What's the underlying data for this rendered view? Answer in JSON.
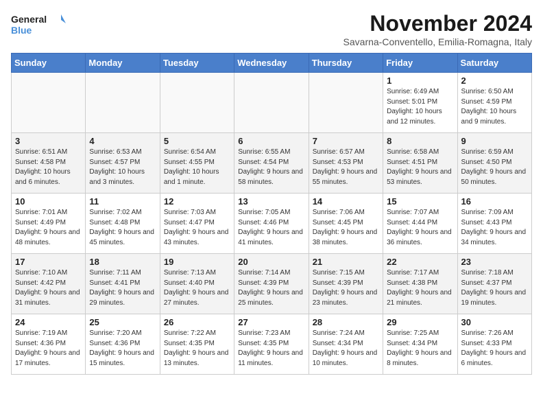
{
  "header": {
    "logo_line1": "General",
    "logo_line2": "Blue",
    "month": "November 2024",
    "location": "Savarna-Conventello, Emilia-Romagna, Italy"
  },
  "columns": [
    "Sunday",
    "Monday",
    "Tuesday",
    "Wednesday",
    "Thursday",
    "Friday",
    "Saturday"
  ],
  "weeks": [
    [
      {
        "day": "",
        "info": ""
      },
      {
        "day": "",
        "info": ""
      },
      {
        "day": "",
        "info": ""
      },
      {
        "day": "",
        "info": ""
      },
      {
        "day": "",
        "info": ""
      },
      {
        "day": "1",
        "info": "Sunrise: 6:49 AM\nSunset: 5:01 PM\nDaylight: 10 hours and 12 minutes."
      },
      {
        "day": "2",
        "info": "Sunrise: 6:50 AM\nSunset: 4:59 PM\nDaylight: 10 hours and 9 minutes."
      }
    ],
    [
      {
        "day": "3",
        "info": "Sunrise: 6:51 AM\nSunset: 4:58 PM\nDaylight: 10 hours and 6 minutes."
      },
      {
        "day": "4",
        "info": "Sunrise: 6:53 AM\nSunset: 4:57 PM\nDaylight: 10 hours and 3 minutes."
      },
      {
        "day": "5",
        "info": "Sunrise: 6:54 AM\nSunset: 4:55 PM\nDaylight: 10 hours and 1 minute."
      },
      {
        "day": "6",
        "info": "Sunrise: 6:55 AM\nSunset: 4:54 PM\nDaylight: 9 hours and 58 minutes."
      },
      {
        "day": "7",
        "info": "Sunrise: 6:57 AM\nSunset: 4:53 PM\nDaylight: 9 hours and 55 minutes."
      },
      {
        "day": "8",
        "info": "Sunrise: 6:58 AM\nSunset: 4:51 PM\nDaylight: 9 hours and 53 minutes."
      },
      {
        "day": "9",
        "info": "Sunrise: 6:59 AM\nSunset: 4:50 PM\nDaylight: 9 hours and 50 minutes."
      }
    ],
    [
      {
        "day": "10",
        "info": "Sunrise: 7:01 AM\nSunset: 4:49 PM\nDaylight: 9 hours and 48 minutes."
      },
      {
        "day": "11",
        "info": "Sunrise: 7:02 AM\nSunset: 4:48 PM\nDaylight: 9 hours and 45 minutes."
      },
      {
        "day": "12",
        "info": "Sunrise: 7:03 AM\nSunset: 4:47 PM\nDaylight: 9 hours and 43 minutes."
      },
      {
        "day": "13",
        "info": "Sunrise: 7:05 AM\nSunset: 4:46 PM\nDaylight: 9 hours and 41 minutes."
      },
      {
        "day": "14",
        "info": "Sunrise: 7:06 AM\nSunset: 4:45 PM\nDaylight: 9 hours and 38 minutes."
      },
      {
        "day": "15",
        "info": "Sunrise: 7:07 AM\nSunset: 4:44 PM\nDaylight: 9 hours and 36 minutes."
      },
      {
        "day": "16",
        "info": "Sunrise: 7:09 AM\nSunset: 4:43 PM\nDaylight: 9 hours and 34 minutes."
      }
    ],
    [
      {
        "day": "17",
        "info": "Sunrise: 7:10 AM\nSunset: 4:42 PM\nDaylight: 9 hours and 31 minutes."
      },
      {
        "day": "18",
        "info": "Sunrise: 7:11 AM\nSunset: 4:41 PM\nDaylight: 9 hours and 29 minutes."
      },
      {
        "day": "19",
        "info": "Sunrise: 7:13 AM\nSunset: 4:40 PM\nDaylight: 9 hours and 27 minutes."
      },
      {
        "day": "20",
        "info": "Sunrise: 7:14 AM\nSunset: 4:39 PM\nDaylight: 9 hours and 25 minutes."
      },
      {
        "day": "21",
        "info": "Sunrise: 7:15 AM\nSunset: 4:39 PM\nDaylight: 9 hours and 23 minutes."
      },
      {
        "day": "22",
        "info": "Sunrise: 7:17 AM\nSunset: 4:38 PM\nDaylight: 9 hours and 21 minutes."
      },
      {
        "day": "23",
        "info": "Sunrise: 7:18 AM\nSunset: 4:37 PM\nDaylight: 9 hours and 19 minutes."
      }
    ],
    [
      {
        "day": "24",
        "info": "Sunrise: 7:19 AM\nSunset: 4:36 PM\nDaylight: 9 hours and 17 minutes."
      },
      {
        "day": "25",
        "info": "Sunrise: 7:20 AM\nSunset: 4:36 PM\nDaylight: 9 hours and 15 minutes."
      },
      {
        "day": "26",
        "info": "Sunrise: 7:22 AM\nSunset: 4:35 PM\nDaylight: 9 hours and 13 minutes."
      },
      {
        "day": "27",
        "info": "Sunrise: 7:23 AM\nSunset: 4:35 PM\nDaylight: 9 hours and 11 minutes."
      },
      {
        "day": "28",
        "info": "Sunrise: 7:24 AM\nSunset: 4:34 PM\nDaylight: 9 hours and 10 minutes."
      },
      {
        "day": "29",
        "info": "Sunrise: 7:25 AM\nSunset: 4:34 PM\nDaylight: 9 hours and 8 minutes."
      },
      {
        "day": "30",
        "info": "Sunrise: 7:26 AM\nSunset: 4:33 PM\nDaylight: 9 hours and 6 minutes."
      }
    ]
  ]
}
